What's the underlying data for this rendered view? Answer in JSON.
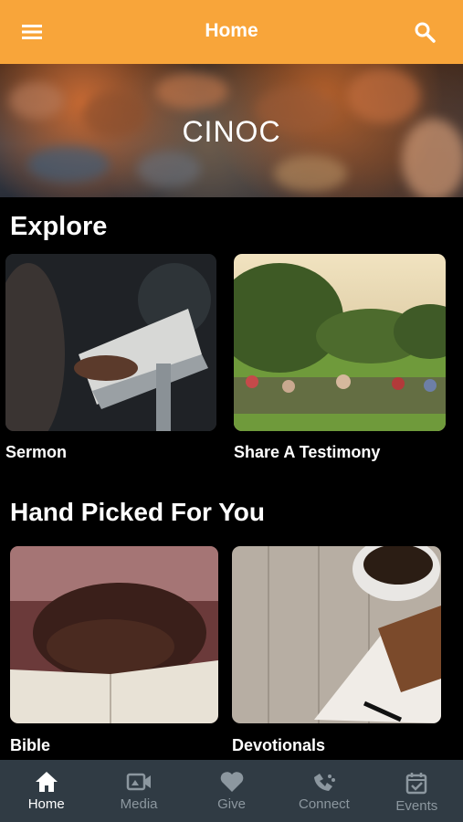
{
  "header": {
    "title": "Home",
    "menu_icon": "menu-icon",
    "search_icon": "search-icon",
    "background": "#f8a53a"
  },
  "hero": {
    "title": "CINOC"
  },
  "explore": {
    "title": "Explore",
    "cards": [
      {
        "label": "Sermon"
      },
      {
        "label": "Share A Testimony"
      }
    ]
  },
  "handpicked": {
    "title": "Hand Picked For You",
    "cards": [
      {
        "label": "Bible"
      },
      {
        "label": "Devotionals"
      }
    ]
  },
  "tabbar": {
    "tabs": [
      {
        "label": "Home",
        "icon": "home-icon",
        "active": true
      },
      {
        "label": "Media",
        "icon": "video-icon",
        "active": false
      },
      {
        "label": "Give",
        "icon": "heart-icon",
        "active": false
      },
      {
        "label": "Connect",
        "icon": "connect-icon",
        "active": false
      },
      {
        "label": "Events",
        "icon": "calendar-check-icon",
        "active": false
      }
    ]
  }
}
